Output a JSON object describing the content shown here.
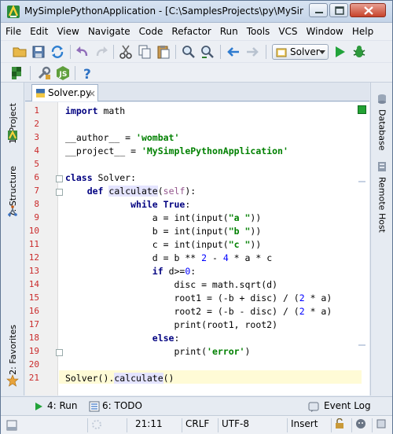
{
  "window": {
    "title": "MySimplePythonApplication - [C:\\SamplesProjects\\py\\MySimpleP...",
    "app_icon": "pycharm-logo-icon"
  },
  "menu": [
    "File",
    "Edit",
    "View",
    "Navigate",
    "Code",
    "Refactor",
    "Run",
    "Tools",
    "VCS",
    "Window",
    "Help"
  ],
  "toolbar": {
    "run_config_label": "Solver"
  },
  "left_tools": {
    "project": "1: Project",
    "structure": "7: Structure",
    "favorites": "2: Favorites"
  },
  "right_tools": {
    "database": "Database",
    "remote_host": "Remote Host"
  },
  "editor": {
    "tab_label": "Solver.py",
    "line_numbers": [
      "1",
      "2",
      "3",
      "4",
      "5",
      "6",
      "7",
      "8",
      "9",
      "10",
      "11",
      "12",
      "13",
      "14",
      "15",
      "16",
      "17",
      "18",
      "19",
      "20",
      "21"
    ],
    "current_line": "21"
  },
  "bottom_tools": {
    "run": "4: Run",
    "todo": "6: TODO",
    "event_log": "Event Log"
  },
  "status": {
    "position": "21:11",
    "line_sep": "CRLF",
    "encoding": "UTF-8",
    "mode": "Insert"
  },
  "colors": {
    "keyword": "#000080",
    "string": "#008000",
    "number": "#0000ff",
    "self": "#94558d",
    "line_number": "#ca2b2b",
    "current_line_bg": "#fffbd6"
  }
}
